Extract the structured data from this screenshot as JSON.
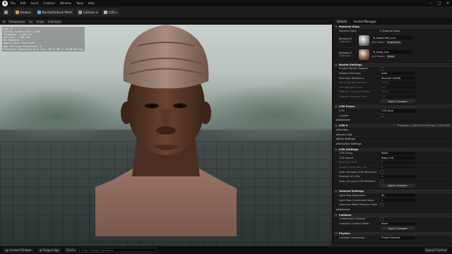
{
  "menu": [
    "File",
    "Edit",
    "Asset",
    "Collision",
    "Window",
    "Tools",
    "Help"
  ],
  "toolbar": {
    "browse": "Browse",
    "nanite": "Nanite/Fallback Mesh",
    "collision": "Collision",
    "lod": "LOD"
  },
  "viewport_toolbar": {
    "perspective": "Perspective",
    "lit": "Lit",
    "show": "Show",
    "lod": "LOD Auto"
  },
  "stats": [
    "LOD: 0",
    "Current Screen Size: 1.000",
    "Triangles: 1,400,129",
    "Vertices: 1,250,302",
    "UV Channels: 1",
    "Approx Size: 55x17x170",
    "Num Collision Primitives: 0",
    "Estimated Compressed Disk Size: 99.27 MB (1.19 MB Nanite)"
  ],
  "panel": {
    "tab_details": "Details",
    "tab_socket": "Socket Manager",
    "material_slots": "Material Slots",
    "material_slots_value": "2 Material Slots",
    "element0": "Element 0",
    "element0_highlight": "Highlight",
    "element0_material": "M_HeadCloth_Inst",
    "element0_slot_name": "Slot Name",
    "element0_slot": "wrapCloth",
    "element1": "Element 1",
    "element1_highlight": "Highlight",
    "element1_material": "M_Head_Inst",
    "element1_slot_name": "Slot Name",
    "element1_slot": "Head",
    "nanite_settings": "Nanite Settings",
    "nanite_rows": [
      {
        "label": "Enable Nanite Support",
        "value": "",
        "type": "check"
      },
      {
        "label": "Position Precision",
        "value": "Auto",
        "type": "val"
      },
      {
        "label": "Minimum Residency",
        "value": "Minimal (32KB)",
        "type": "val"
      },
      {
        "label": "Keep Triangle Percent",
        "value": "100.0",
        "type": "dim"
      },
      {
        "label": "Trim Relative Error",
        "value": "0.0",
        "type": "dim"
      },
      {
        "label": "Fallback Triangle Percent",
        "value": "100.0",
        "type": "dim"
      },
      {
        "label": "Fallback Relative Error",
        "value": "1.0",
        "type": "dim"
      },
      {
        "label": "",
        "value": "Apply Changes",
        "type": "btn"
      }
    ],
    "lod_picker": "LOD Picker",
    "lod_rows": [
      {
        "label": "LOD",
        "value": "LOD Auto",
        "type": "val"
      },
      {
        "label": "Custom",
        "value": "",
        "type": "check"
      },
      {
        "label": "Advanced",
        "value": "",
        "type": "none"
      }
    ],
    "lod0": "LOD 0",
    "lod0_info": "Triangles: 1,400,129 Vertices: 1,250,302",
    "lod0_rows": [
      {
        "label": "Sections",
        "value": "",
        "type": "none"
      },
      {
        "label": "Screen Size",
        "value": "",
        "type": "none"
      },
      {
        "label": "Build Settings",
        "value": "",
        "type": "none"
      },
      {
        "label": "Reduction Settings",
        "value": "",
        "type": "none"
      }
    ],
    "lod_settings": "LOD Settings",
    "lod_settings_rows": [
      {
        "label": "LOD Group",
        "value": "None",
        "type": "val"
      },
      {
        "label": "LOD Import",
        "value": "Base LOD",
        "type": "val"
      },
      {
        "label": "Minimum LOD",
        "value": "0",
        "type": "dim"
      },
      {
        "label": "Quality Level Min LOD",
        "value": "0",
        "type": "dim"
      },
      {
        "label": "Auto Compute LOD Distances",
        "value": "",
        "type": "check"
      },
      {
        "label": "Number of LODs",
        "value": "1",
        "type": "val"
      },
      {
        "label": "Auto Compute LOD Distance",
        "value": "",
        "type": "check"
      },
      {
        "label": "",
        "value": "Apply Changes",
        "type": "btn"
      }
    ],
    "general_settings": "General Settings",
    "general_rows": [
      {
        "label": "Light Map Resolution",
        "value": "64",
        "type": "val"
      },
      {
        "label": "Light Map Coordinate Index",
        "value": "1",
        "type": "val"
      },
      {
        "label": "Generate Mesh Distance Field",
        "value": "",
        "type": "check"
      },
      {
        "label": "Advanced",
        "value": "",
        "type": "none"
      }
    ],
    "collision": "Collision",
    "collision_rows": [
      {
        "label": "Customized Collision",
        "value": "",
        "type": "check"
      },
      {
        "label": "Complex Collision Mesh",
        "value": "None",
        "type": "val"
      },
      {
        "label": "",
        "value": "Apply Changes",
        "type": "btn"
      }
    ],
    "physics": "Physics",
    "physics_rows": [
      {
        "label": "Collision Complexity",
        "value": "Project Default",
        "type": "val"
      }
    ]
  },
  "bottombar": {
    "content_drawer": "Content Drawer",
    "output_log": "Output Log",
    "cmd": "Cmd",
    "console_placeholder": "Enter Console Command",
    "source_control": "Source Control"
  },
  "colors": {
    "accent": "#2e6fc4",
    "panel": "#1a1a1a",
    "header": "#262626"
  }
}
